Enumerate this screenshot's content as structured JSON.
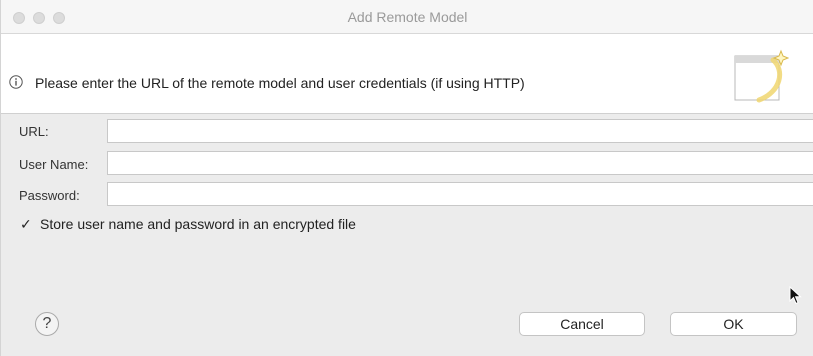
{
  "window": {
    "title": "Add Remote Model"
  },
  "banner": {
    "message": "Please enter the URL of the remote model and user credentials (if using HTTP)"
  },
  "form": {
    "fields": [
      {
        "label": "URL:",
        "value": "",
        "placeholder": ""
      },
      {
        "label": "User Name:",
        "value": "",
        "placeholder": ""
      },
      {
        "label": "Password:",
        "value": "",
        "placeholder": ""
      }
    ],
    "store_checkbox": {
      "checked": true,
      "mark": "✓",
      "label": "Store user name and password in an encrypted file"
    }
  },
  "buttons": {
    "help": "?",
    "cancel": "Cancel",
    "ok": "OK"
  },
  "icons": {
    "info": "info-icon",
    "wizard": "wizard-banner-icon",
    "help": "help-icon",
    "cursor": "mouse-cursor-icon"
  }
}
